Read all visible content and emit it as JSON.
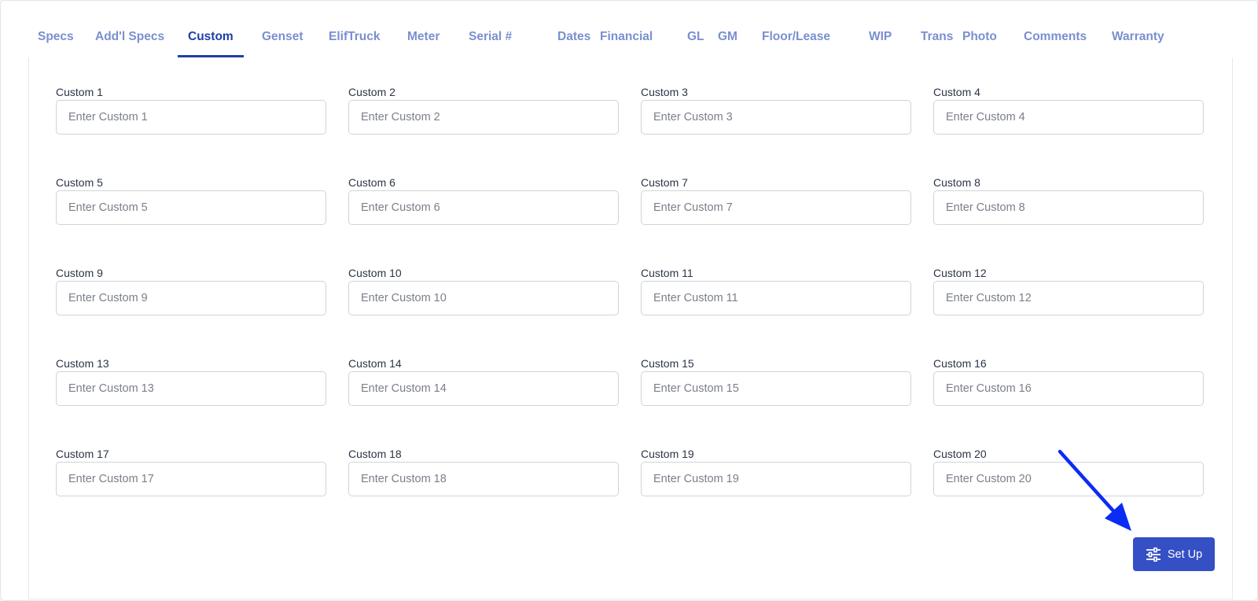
{
  "tabs": [
    {
      "label": "Specs",
      "active": false
    },
    {
      "label": "Add'l Specs",
      "active": false
    },
    {
      "label": "Custom",
      "active": true
    },
    {
      "label": "Genset",
      "active": false
    },
    {
      "label": "ElifTruck",
      "active": false
    },
    {
      "label": "Meter",
      "active": false
    },
    {
      "label": "Serial #",
      "active": false
    },
    {
      "label": "Dates",
      "active": false
    },
    {
      "label": "Financial",
      "active": false
    },
    {
      "label": "GL",
      "active": false
    },
    {
      "label": "GM",
      "active": false
    },
    {
      "label": "Floor/Lease",
      "active": false
    },
    {
      "label": "WIP",
      "active": false
    },
    {
      "label": "Trans",
      "active": false
    },
    {
      "label": "Photo",
      "active": false
    },
    {
      "label": "Comments",
      "active": false
    },
    {
      "label": "Warranty",
      "active": false
    }
  ],
  "fields": [
    {
      "label": "Custom 1",
      "placeholder": "Enter Custom 1",
      "value": ""
    },
    {
      "label": "Custom 2",
      "placeholder": "Enter Custom 2",
      "value": ""
    },
    {
      "label": "Custom 3",
      "placeholder": "Enter Custom 3",
      "value": ""
    },
    {
      "label": "Custom 4",
      "placeholder": "Enter Custom 4",
      "value": ""
    },
    {
      "label": "Custom 5",
      "placeholder": "Enter Custom 5",
      "value": ""
    },
    {
      "label": "Custom 6",
      "placeholder": "Enter Custom 6",
      "value": ""
    },
    {
      "label": "Custom 7",
      "placeholder": "Enter Custom 7",
      "value": ""
    },
    {
      "label": "Custom 8",
      "placeholder": "Enter Custom 8",
      "value": ""
    },
    {
      "label": "Custom 9",
      "placeholder": "Enter Custom 9",
      "value": ""
    },
    {
      "label": "Custom 10",
      "placeholder": "Enter Custom 10",
      "value": ""
    },
    {
      "label": "Custom 11",
      "placeholder": "Enter Custom 11",
      "value": ""
    },
    {
      "label": "Custom 12",
      "placeholder": "Enter Custom 12",
      "value": ""
    },
    {
      "label": "Custom 13",
      "placeholder": "Enter Custom 13",
      "value": ""
    },
    {
      "label": "Custom 14",
      "placeholder": "Enter Custom 14",
      "value": ""
    },
    {
      "label": "Custom 15",
      "placeholder": "Enter Custom 15",
      "value": ""
    },
    {
      "label": "Custom 16",
      "placeholder": "Enter Custom 16",
      "value": ""
    },
    {
      "label": "Custom 17",
      "placeholder": "Enter Custom 17",
      "value": ""
    },
    {
      "label": "Custom 18",
      "placeholder": "Enter Custom 18",
      "value": ""
    },
    {
      "label": "Custom 19",
      "placeholder": "Enter Custom 19",
      "value": ""
    },
    {
      "label": "Custom 20",
      "placeholder": "Enter Custom 20",
      "value": ""
    }
  ],
  "setup_button": {
    "label": "Set Up",
    "icon": "sliders-icon"
  },
  "colors": {
    "accent": "#1f3fa8",
    "tab_inactive": "#7a8fd0",
    "button": "#3550c4",
    "annotation_arrow": "#0a2cf5"
  }
}
